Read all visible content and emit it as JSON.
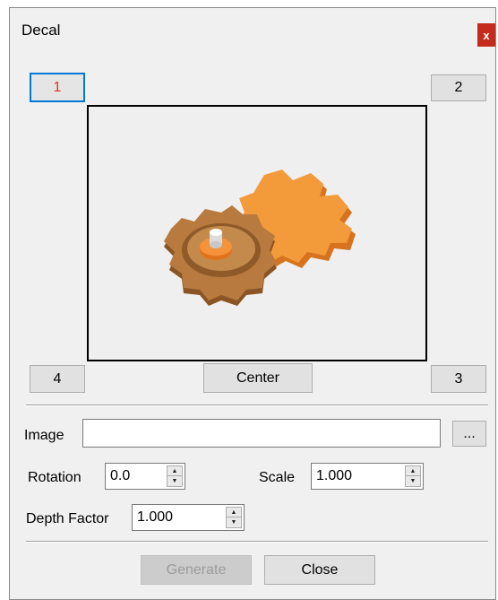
{
  "window": {
    "title": "Decal",
    "close_label": "x"
  },
  "view_buttons": {
    "b1": "1",
    "b2": "2",
    "b3": "3",
    "b4": "4",
    "center": "Center"
  },
  "form": {
    "image_label": "Image",
    "image_value": "",
    "browse_label": "...",
    "rotation_label": "Rotation",
    "rotation_value": "0.0",
    "scale_label": "Scale",
    "scale_value": "1.000",
    "depth_label": "Depth Factor",
    "depth_value": "1.000"
  },
  "actions": {
    "generate": "Generate",
    "close": "Close"
  },
  "colors": {
    "accent": "#0078d7",
    "close_bg": "#c42b1c",
    "gear_brown": "#b0733a",
    "gear_orange": "#f08a2a"
  }
}
